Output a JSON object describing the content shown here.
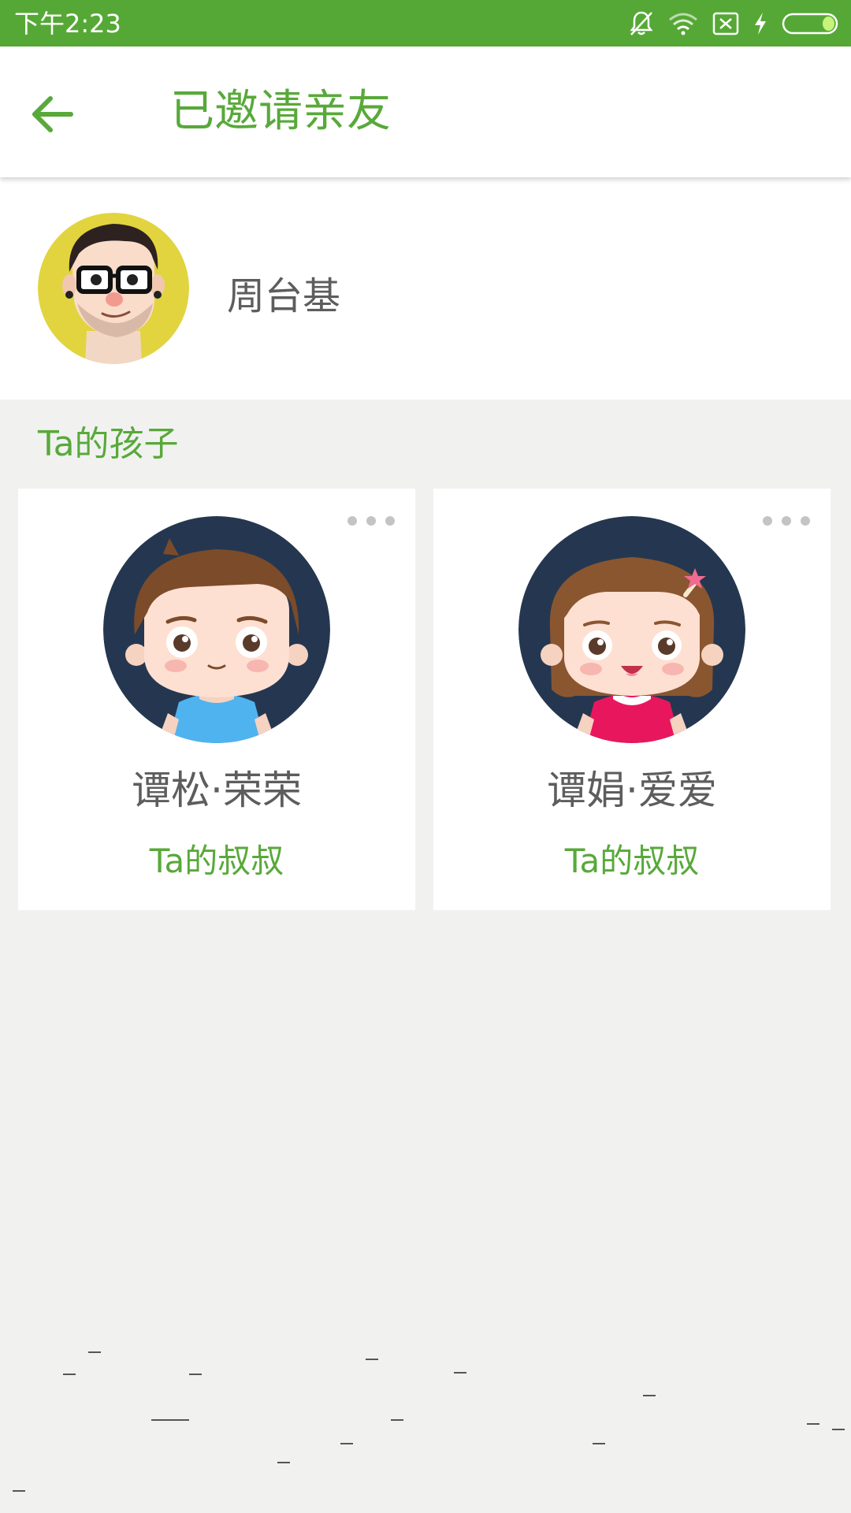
{
  "status_bar": {
    "time": "下午2:23",
    "icons": [
      "bell-off-icon",
      "wifi-icon",
      "sim-off-icon",
      "charging-icon",
      "battery-icon"
    ]
  },
  "app_bar": {
    "back_icon": "arrow-left-icon",
    "title": "已邀请亲友"
  },
  "profile": {
    "name": "周台基"
  },
  "section": {
    "label": "Ta的孩子"
  },
  "children": [
    {
      "name": "谭松·荣荣",
      "relation": "Ta的叔叔"
    },
    {
      "name": "谭娟·爱爱",
      "relation": "Ta的叔叔"
    }
  ],
  "colors": {
    "accent": "#58a93a",
    "status_bar": "#56a836",
    "text_gray": "#5d5d5d",
    "background": "#f1f2f0",
    "avatar_bg_dark": "#253750",
    "avatar_bg_yellow": "#e2d43f"
  }
}
